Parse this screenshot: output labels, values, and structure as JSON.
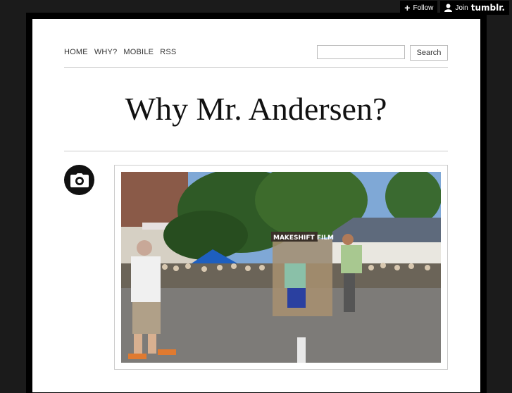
{
  "tumblr_bar": {
    "follow_label": "Follow",
    "join_label": "Join",
    "brand": "tumblr."
  },
  "nav": {
    "items": [
      "HOME",
      "WHY?",
      "MOBILE",
      "RSS"
    ]
  },
  "search": {
    "placeholder": "",
    "button_label": "Search"
  },
  "blog": {
    "title": "Why Mr. Andersen?"
  },
  "photo": {
    "sign_text": "MAKESHIFT FILM"
  },
  "icons": {
    "post_type": "camera-icon"
  },
  "colors": {
    "frame": "#000000",
    "page": "#ffffff",
    "background": "#1b1b1b"
  }
}
